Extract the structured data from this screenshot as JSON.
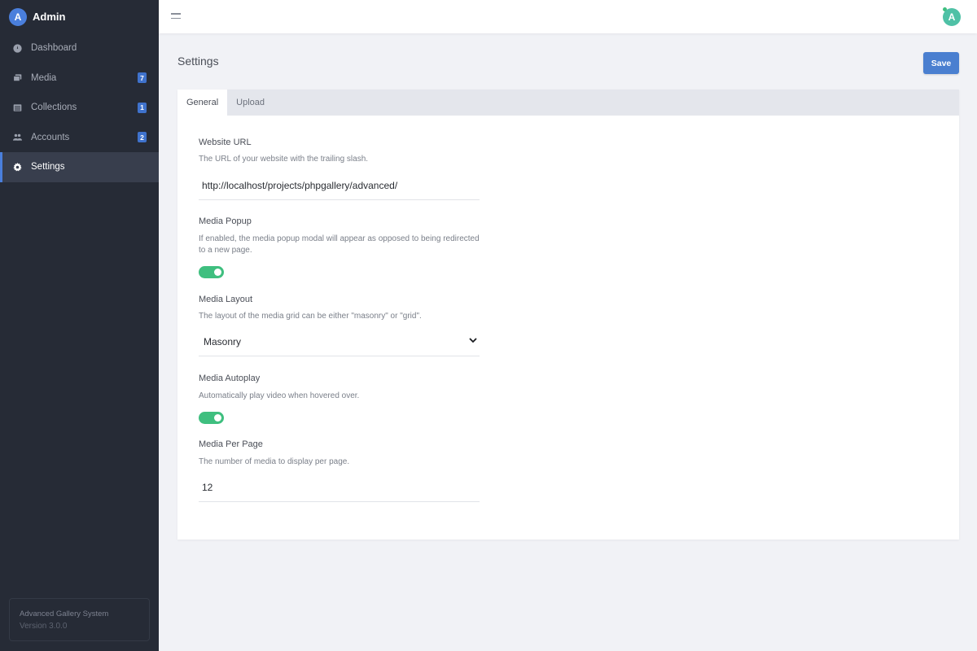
{
  "brand": {
    "avatar_letter": "A",
    "name": "Admin"
  },
  "sidebar": {
    "items": [
      {
        "label": "Dashboard",
        "icon": "dashboard-icon",
        "badge": null
      },
      {
        "label": "Media",
        "icon": "images-icon",
        "badge": "7"
      },
      {
        "label": "Collections",
        "icon": "list-icon",
        "badge": "1"
      },
      {
        "label": "Accounts",
        "icon": "users-icon",
        "badge": "2"
      },
      {
        "label": "Settings",
        "icon": "gear-icon",
        "badge": null,
        "active": true
      }
    ],
    "footer": {
      "title": "Advanced Gallery System",
      "version": "Version 3.0.0"
    }
  },
  "topbar": {
    "user_avatar_letter": "A",
    "online_status_color": "#3fbf7f"
  },
  "page": {
    "title": "Settings",
    "save_label": "Save"
  },
  "tabs": [
    {
      "label": "General",
      "active": true
    },
    {
      "label": "Upload",
      "active": false
    }
  ],
  "form": {
    "website_url": {
      "title": "Website URL",
      "description": "The URL of your website with the trailing slash.",
      "value": "http://localhost/projects/phpgallery/advanced/"
    },
    "media_popup": {
      "title": "Media Popup",
      "description": "If enabled, the media popup modal will appear as opposed to being redirected to a new page.",
      "enabled": true
    },
    "media_layout": {
      "title": "Media Layout",
      "description": "The layout of the media grid can be either \"masonry\" or \"grid\".",
      "value": "Masonry"
    },
    "media_autoplay": {
      "title": "Media Autoplay",
      "description": "Automatically play video when hovered over.",
      "enabled": true
    },
    "media_per_page": {
      "title": "Media Per Page",
      "description": "The number of media to display per page.",
      "value": "12"
    }
  },
  "colors": {
    "sidebar_bg": "#262b36",
    "accent": "#4a7fdc",
    "toggle_on": "#3fbf7f",
    "badge": "#3f72cc"
  }
}
